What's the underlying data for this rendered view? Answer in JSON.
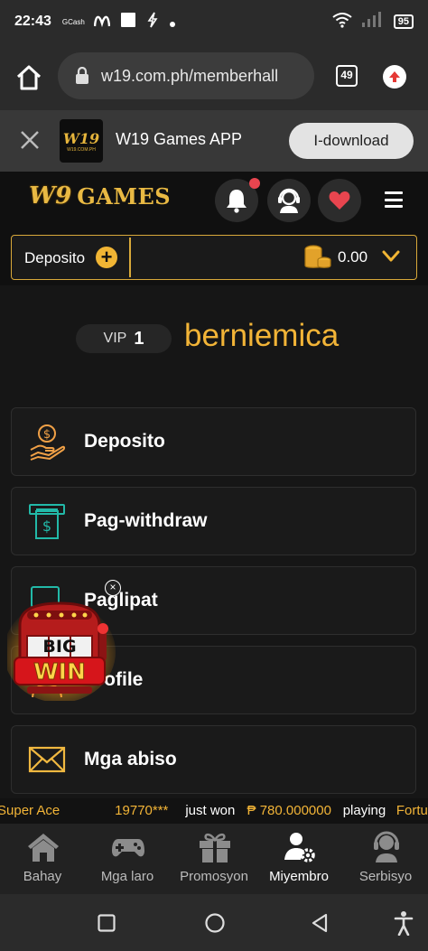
{
  "status_bar": {
    "time": "22:43",
    "gcash": "GCash",
    "battery": "95"
  },
  "browser": {
    "url": "w19.com.ph/memberhall",
    "tab_count": "49"
  },
  "app_banner": {
    "app_name": "W19 Games APP",
    "logo_text": "W19",
    "logo_domain": "W19.COM.PH",
    "download_label": "I-download"
  },
  "site_header": {
    "logo_mark": "W9",
    "logo_text": "GAMES"
  },
  "deposit_bar": {
    "label": "Deposito",
    "plus": "+",
    "balance": "0.00"
  },
  "profile": {
    "vip_label": "VIP",
    "vip_level": "1",
    "username": "berniemica"
  },
  "menu": [
    {
      "label": "Deposito",
      "icon": "hand-coin-icon"
    },
    {
      "label": "Pag-withdraw",
      "icon": "atm-withdraw-icon"
    },
    {
      "label": "Paglipat",
      "icon": "transfer-icon"
    },
    {
      "label": "Profile",
      "icon": "profile-icon"
    },
    {
      "label": "Mga abiso",
      "icon": "envelope-icon"
    }
  ],
  "big_win": {
    "line1": "BIG",
    "line2": "WIN",
    "close": "×"
  },
  "ticker": {
    "game_left": "Super Ace",
    "user": "19770***",
    "just_won": "just won",
    "amount": "₱ 780.000000",
    "playing": "playing",
    "game_right": "Fortun"
  },
  "bottom_nav": [
    {
      "label": "Bahay",
      "icon": "home-icon"
    },
    {
      "label": "Mga laro",
      "icon": "gamepad-icon"
    },
    {
      "label": "Promosyon",
      "icon": "gift-icon"
    },
    {
      "label": "Miyembro",
      "icon": "member-icon",
      "active": true
    },
    {
      "label": "Serbisyo",
      "icon": "support-icon"
    }
  ],
  "colors": {
    "accent_gold": "#f2b437",
    "background": "#161616",
    "heart": "#e8454f"
  }
}
